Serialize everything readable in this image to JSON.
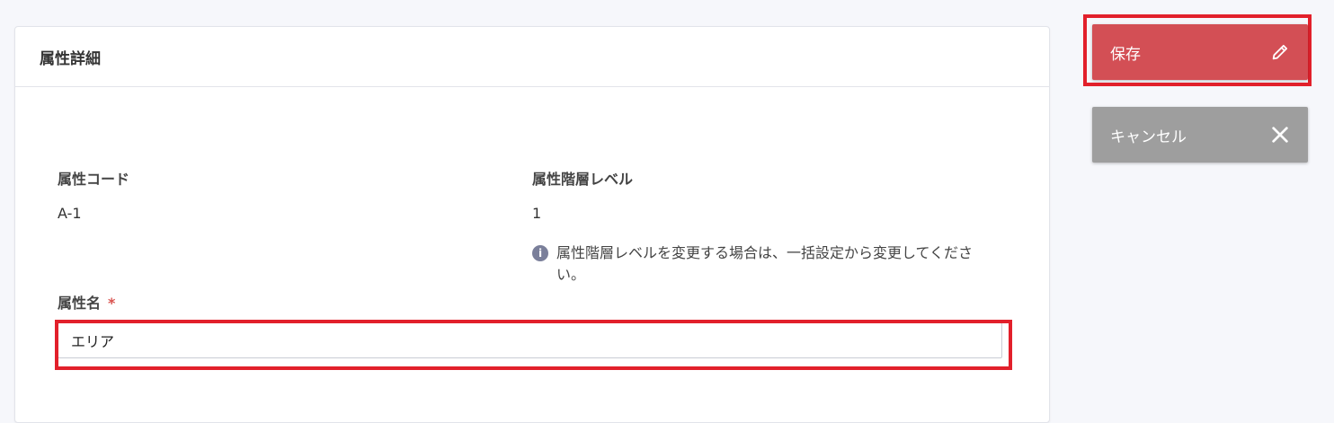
{
  "card": {
    "title": "属性詳細"
  },
  "fields": {
    "code": {
      "label": "属性コード",
      "value": "A-1"
    },
    "level": {
      "label": "属性階層レベル",
      "value": "1",
      "note": "属性階層レベルを変更する場合は、一括設定から変更してください。",
      "note_icon": "info-icon"
    },
    "name": {
      "label": "属性名",
      "required_mark": "*",
      "value": "エリア",
      "placeholder": ""
    }
  },
  "actions": {
    "save": {
      "label": "保存",
      "icon": "pencil-icon",
      "color": "#d34f55"
    },
    "cancel": {
      "label": "キャンセル",
      "icon": "close-icon",
      "color": "#9e9e9e"
    }
  },
  "highlight_color": "#e2202b"
}
